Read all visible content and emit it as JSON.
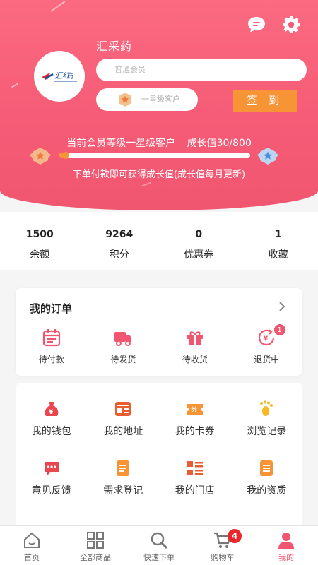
{
  "header": {
    "shop_name": "汇采药",
    "member_placeholder": "普通会员",
    "level_label": "一星级客户",
    "sign_label": "签 到",
    "level_text": "当前会员等级一星级客户",
    "growth_text": "成长值30/800",
    "growth_progress": 0.0375,
    "tip": "下单付款即可获得成长值(成长值每月更新)"
  },
  "stats": [
    {
      "value": "1500",
      "label": "余额"
    },
    {
      "value": "9264",
      "label": "积分"
    },
    {
      "value": "0",
      "label": "优惠券"
    },
    {
      "value": "1",
      "label": "收藏"
    }
  ],
  "orders": {
    "title": "我的订单",
    "items": [
      {
        "label": "待付款",
        "icon": "calendar-icon"
      },
      {
        "label": "待发货",
        "icon": "truck-icon"
      },
      {
        "label": "待收货",
        "icon": "gift-icon"
      },
      {
        "label": "退货中",
        "icon": "refund-icon",
        "badge": "1"
      }
    ]
  },
  "menu": [
    {
      "label": "我的钱包",
      "icon": "money-bag-icon"
    },
    {
      "label": "我的地址",
      "icon": "address-card-icon"
    },
    {
      "label": "我的卡券",
      "icon": "coupon-icon"
    },
    {
      "label": "浏览记录",
      "icon": "footprint-icon"
    },
    {
      "label": "意见反馈",
      "icon": "feedback-icon"
    },
    {
      "label": "需求登记",
      "icon": "form-icon"
    },
    {
      "label": "我的门店",
      "icon": "store-list-icon"
    },
    {
      "label": "我的资质",
      "icon": "document-icon"
    }
  ],
  "tabbar": [
    {
      "label": "首页",
      "icon": "home-icon"
    },
    {
      "label": "全部商品",
      "icon": "grid-icon"
    },
    {
      "label": "快速下单",
      "icon": "search-icon"
    },
    {
      "label": "购物车",
      "icon": "cart-icon",
      "badge": "4"
    },
    {
      "label": "我的",
      "icon": "user-icon",
      "active": true
    }
  ],
  "colors": {
    "header": "#f65c77",
    "accent": "#f79435",
    "active_tab": "#f0566f",
    "badge": "#e8262b"
  }
}
